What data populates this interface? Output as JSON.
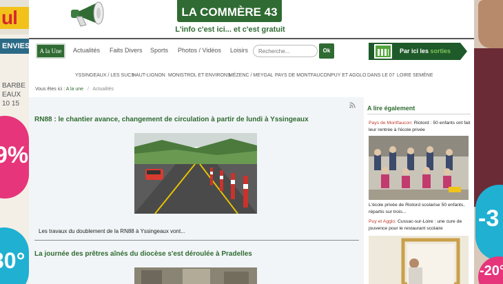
{
  "ads": {
    "left_brand": "ul",
    "left_band": "ENVIES",
    "left_text_lines": [
      "BARBE",
      "EAUX",
      "10 15"
    ],
    "left_pink_value": "9%",
    "left_cyan_value": "30°",
    "right_cyan_value": "-3",
    "right_pink_value": "-20°"
  },
  "header": {
    "logo": "LA COMMÈRE 43",
    "tagline": "L'info c'est ici... et c'est gratuit"
  },
  "nav": {
    "items": [
      {
        "label": "A la Une"
      },
      {
        "label": "Actualités"
      },
      {
        "label": "Faits Divers"
      },
      {
        "label": "Sports"
      },
      {
        "label": "Photos / Vidéos"
      },
      {
        "label": "Loisirs"
      }
    ],
    "search_placeholder": "Recherche...",
    "search_button": "Ok",
    "sorties_prefix": "Par ici les ",
    "sorties_highlight": "sorties"
  },
  "subnav": {
    "items": [
      "YSSINGEAUX / LES SUCS",
      "HAUT-LIGNON",
      "MONISTROL ET ENVIRONS",
      "MÉZENC / MEYGAL",
      "PAYS DE MONTFAUCON",
      "PUY ET AGGLO",
      "DANS LE 07",
      "LOIRE SEMÈNE"
    ]
  },
  "breadcrumb": {
    "prefix": "Vous êtes ici :",
    "link": "A la une",
    "separator": "/",
    "current": "Actualités"
  },
  "main": {
    "articles": [
      {
        "title": "RN88 : le chantier avance, changement de circulation à partir de lundi à Yssingeaux",
        "summary": "Les travaux du doublement de la RN88 à Yssingeaux vont..."
      },
      {
        "title": "La journée des prêtres aînés du diocèse s'est déroulée à Pradelles"
      }
    ]
  },
  "sidebar": {
    "title": "A lire également",
    "items": [
      {
        "category": "Pays de Montfaucon:",
        "headline": " Riotord : 50 enfants ont fait leur rentrée à l'école privée",
        "caption": "L'école privée de Riotord scolarise 50 enfants, répartis sur trois..."
      },
      {
        "category": "Puy et Agglo:",
        "headline": " Cussac-sur-Loire : une cure de jouvence pour le restaurant scolaire"
      }
    ]
  },
  "colors": {
    "brand_green": "#2f6b32",
    "category_red": "#c0392b"
  },
  "icons": {
    "megaphone": "megaphone-icon",
    "rss": "rss-icon",
    "calendar": "calendar-icon"
  }
}
